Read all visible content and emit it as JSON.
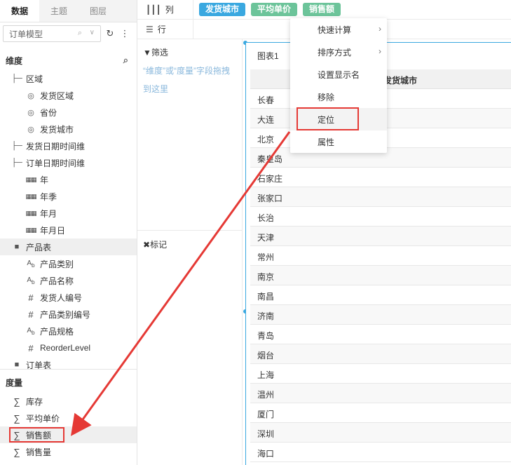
{
  "left_panel": {
    "tabs": [
      {
        "label": "数据",
        "active": true
      },
      {
        "label": "主题",
        "active": false
      },
      {
        "label": "图层",
        "active": false
      }
    ],
    "model_select": {
      "value": "订单模型"
    },
    "dimensions": {
      "header": "维度",
      "items": [
        {
          "label": "区域",
          "icon": "hierarchy-icon",
          "level": 0
        },
        {
          "label": "发货区域",
          "icon": "globe-icon",
          "level": 1
        },
        {
          "label": "省份",
          "icon": "globe-icon",
          "level": 1
        },
        {
          "label": "发货城市",
          "icon": "globe-icon",
          "level": 1
        },
        {
          "label": "发货日期时间维",
          "icon": "hierarchy-icon",
          "level": 0
        },
        {
          "label": "订单日期时间维",
          "icon": "hierarchy-icon",
          "level": 0
        },
        {
          "label": "年",
          "icon": "calendar-icon",
          "level": 1
        },
        {
          "label": "年季",
          "icon": "calendar-icon",
          "level": 1
        },
        {
          "label": "年月",
          "icon": "calendar-icon",
          "level": 1
        },
        {
          "label": "年月日",
          "icon": "calendar-icon",
          "level": 1
        },
        {
          "label": "产品表",
          "icon": "folder-icon",
          "level": 0,
          "highlight": true
        },
        {
          "label": "产品类别",
          "icon": "text-field-icon",
          "level": 1
        },
        {
          "label": "产品名称",
          "icon": "text-field-icon",
          "level": 1
        },
        {
          "label": "发货人编号",
          "icon": "number-field-icon",
          "level": 1
        },
        {
          "label": "产品类别编号",
          "icon": "number-field-icon",
          "level": 1
        },
        {
          "label": "产品规格",
          "icon": "text-field-icon",
          "level": 1
        },
        {
          "label": "ReorderLevel",
          "icon": "number-field-icon",
          "level": 1
        },
        {
          "label": "订单表",
          "icon": "folder-icon",
          "level": 0
        }
      ]
    },
    "measures": {
      "header": "度量",
      "items": [
        {
          "label": "库存",
          "icon": "sigma-icon"
        },
        {
          "label": "平均单价",
          "icon": "sigma-icon"
        },
        {
          "label": "销售额",
          "icon": "sigma-icon",
          "highlight": true
        },
        {
          "label": "销售量",
          "icon": "sigma-icon"
        }
      ]
    }
  },
  "shelves": {
    "column_label": "列",
    "row_label": "行",
    "column_pills": [
      {
        "label": "发货城市",
        "color": "#3aa8e0"
      },
      {
        "label": "平均单价",
        "color": "#6cc49a"
      },
      {
        "label": "销售额",
        "color": "#6cc49a"
      }
    ]
  },
  "filter": {
    "title": "筛选",
    "hint": "“维度”或“度量”字段拖拽到这里",
    "mark_title": "标记"
  },
  "chart": {
    "title": "图表1",
    "column_header": "发货城市",
    "rows": [
      "长春",
      "大连",
      "北京",
      "秦皇岛",
      "石家庄",
      "张家口",
      "长治",
      "天津",
      "常州",
      "南京",
      "南昌",
      "济南",
      "青岛",
      "烟台",
      "上海",
      "温州",
      "厦门",
      "深圳",
      "海口"
    ]
  },
  "context_menu": {
    "items": [
      {
        "label": "快速计算",
        "submenu": true
      },
      {
        "label": "排序方式",
        "submenu": true
      },
      {
        "label": "设置显示名",
        "submenu": false
      },
      {
        "label": "移除",
        "submenu": false
      },
      {
        "label": "定位",
        "submenu": false,
        "hover": true
      },
      {
        "label": "属性",
        "submenu": false
      }
    ]
  },
  "colors": {
    "accent_blue": "#3aa8e0",
    "pill_green": "#6cc49a",
    "annotation_red": "#e53935"
  }
}
